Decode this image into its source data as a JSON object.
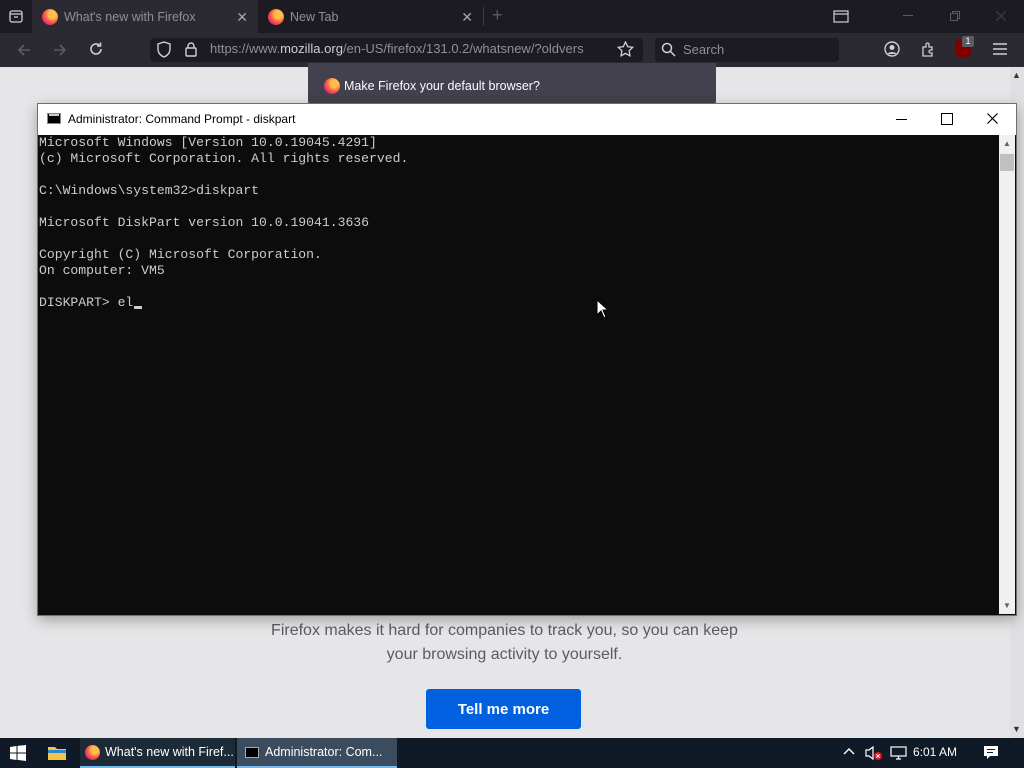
{
  "browser": {
    "tabs": [
      {
        "label": "What's new with Firefox",
        "close": "✕"
      },
      {
        "label": "New Tab",
        "close": "✕"
      }
    ],
    "new_tab": "+",
    "url_prefix": "https://www.",
    "url_domain": "mozilla.org",
    "url_rest": "/en-US/firefox/131.0.2/whatsnew/?oldvers",
    "search_placeholder": "Search",
    "extension_badge": "1"
  },
  "page": {
    "notification": "Make Firefox your default browser?",
    "body_text": "Firefox makes it hard for companies to track you, so you can keep your browsing activity to yourself.",
    "button": "Tell me more"
  },
  "cmd": {
    "title": "Administrator: Command Prompt - diskpart",
    "lines": [
      "Microsoft Windows [Version 10.0.19045.4291]",
      "(c) Microsoft Corporation. All rights reserved.",
      "",
      "C:\\Windows\\system32>diskpart",
      "",
      "Microsoft DiskPart version 10.0.19041.3636",
      "",
      "Copyright (C) Microsoft Corporation.",
      "On computer: VM5",
      ""
    ],
    "prompt": "DISKPART> ",
    "input": "el"
  },
  "taskbar": {
    "apps": [
      {
        "label": "What's new with Firef..."
      },
      {
        "label": "Administrator: Com..."
      }
    ],
    "clock": "6:01 AM"
  },
  "colors": {
    "firefox_dark": "#1c1b22",
    "toolbar": "#2b2a33",
    "cmd_bg": "#0c0c0c",
    "cmd_text": "#cccccc",
    "button_blue": "#0060df",
    "taskbar": "#0f1a26"
  }
}
